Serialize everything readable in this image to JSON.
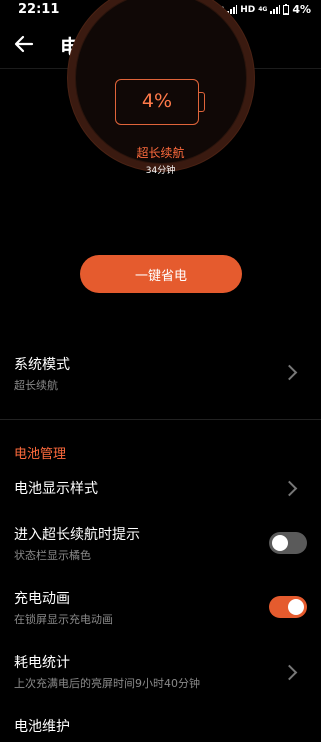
{
  "status_bar": {
    "time": "22:11",
    "net1": "HD",
    "net1_type": "4G",
    "net2": "HD",
    "net2_type": "4G",
    "battery": "4%"
  },
  "header": {
    "title": "电池"
  },
  "gauge": {
    "battery_percent": "4%",
    "mode": "超长续航",
    "time_left": "34分钟",
    "accent": "#ff6b3d"
  },
  "one_key_save": {
    "label": "一键省电",
    "color": "#e55b2e"
  },
  "system_mode": {
    "title": "系统模式",
    "value": "超长续航"
  },
  "section": {
    "title": "电池管理"
  },
  "items": [
    {
      "title": "电池显示样式"
    },
    {
      "title": "进入超长续航时提示",
      "subtitle": "状态栏显示橘色",
      "toggle": false
    },
    {
      "title": "充电动画",
      "subtitle": "在锁屏显示充电动画",
      "toggle": true
    },
    {
      "title": "耗电统计",
      "subtitle": "上次充满电后的亮屏时间9小时40分钟"
    },
    {
      "title": "电池维护"
    }
  ]
}
